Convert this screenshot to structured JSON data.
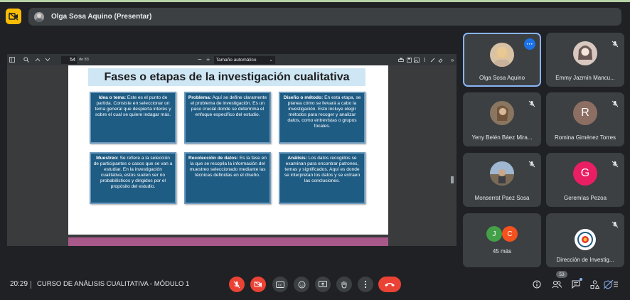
{
  "presenter": {
    "label": "Olga Sosa Aquino (Presentar)"
  },
  "pdf_toolbar": {
    "page_number": "54",
    "page_total": "de 83",
    "zoom": "Tamaño automático"
  },
  "slide": {
    "title": "Fases o etapas de la investigación cualitativa",
    "cards": [
      {
        "heading": "Idea o tema:",
        "body": " Este es el punto de partida. Consiste en seleccionar un tema general que despierta interés y sobre el cual se quiere indagar más."
      },
      {
        "heading": "Problema:",
        "body": " Aquí se define claramente el problema de investigación. Es un paso crucial donde se determina el enfoque específico del estudio."
      },
      {
        "heading": "Diseño o método:",
        "body": " En esta etapa, se planea cómo se llevará a cabo la investigación. Esto incluye elegir métodos para recoger y analizar datos, como entrevistas o grupos focales."
      },
      {
        "heading": "Muestreo:",
        "body": " Se refiere a la selección de participantes o casos que se van a estudiar. En la investigación cualitativa, estos suelen ser no probabilísticos y dirigidos por el propósito del estudio."
      },
      {
        "heading": "Recolección de datos:",
        "body": " Es la fase en la que se recopila la información del muestreo seleccionado mediante las técnicas definidas en el diseño."
      },
      {
        "heading": "Análisis:",
        "body": " Los datos recogidos se examinan para encontrar patrones, temas y significados. Aquí es donde se interpretan los datos y se extraen las conclusiones."
      }
    ]
  },
  "participants": [
    {
      "name": "Olga Sosa Aquino",
      "initial": "",
      "color": "#c9a27e"
    },
    {
      "name": "Emmy Jazmín Mancu...",
      "initial": "",
      "color": "#d9c8c0"
    },
    {
      "name": "Yeny Belén Báez Mira...",
      "initial": "",
      "color": "#8a7660"
    },
    {
      "name": "Romina Giménez Torres",
      "initial": "R",
      "color": "#8d6e63"
    },
    {
      "name": "Monserrat Paez Sosa",
      "initial": "",
      "color": "#6d8fb3"
    },
    {
      "name": "Geremías Pezoa",
      "initial": "G",
      "color": "#e91e63"
    },
    {
      "name": "45 más",
      "initial_a": "J",
      "initial_b": "C",
      "color_a": "#43a047",
      "color_b": "#f4511e"
    },
    {
      "name": "Dirección de Investig...",
      "initial": "",
      "color": "#ffffff"
    }
  ],
  "bottom": {
    "time": "20:29",
    "meeting_title": "CURSO DE ANÁLISIS CUALITATIVA - MÓDULO 1",
    "participant_count": "53"
  },
  "colors": {
    "accent": "#8ab4f8",
    "danger": "#ea4335",
    "card_bg": "#1f5c84",
    "logo": "#fbbc04"
  }
}
